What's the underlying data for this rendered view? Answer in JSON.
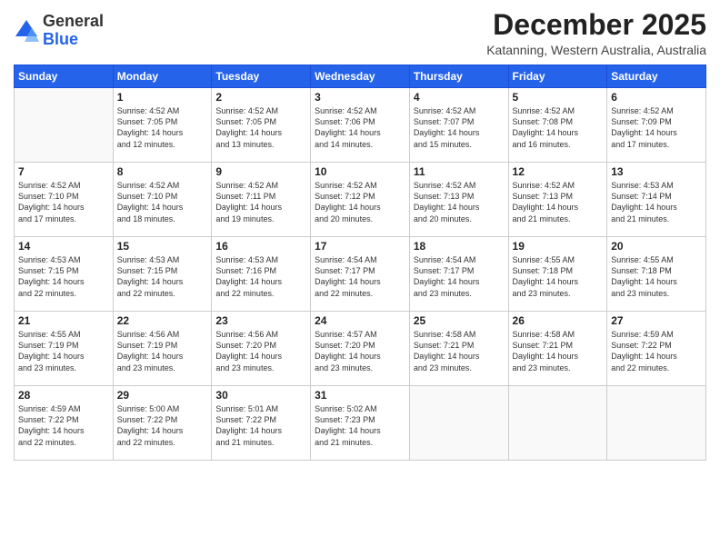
{
  "logo": {
    "general": "General",
    "blue": "Blue"
  },
  "title": "December 2025",
  "location": "Katanning, Western Australia, Australia",
  "days_header": [
    "Sunday",
    "Monday",
    "Tuesday",
    "Wednesday",
    "Thursday",
    "Friday",
    "Saturday"
  ],
  "weeks": [
    [
      {
        "day": "",
        "info": ""
      },
      {
        "day": "1",
        "info": "Sunrise: 4:52 AM\nSunset: 7:05 PM\nDaylight: 14 hours\nand 12 minutes."
      },
      {
        "day": "2",
        "info": "Sunrise: 4:52 AM\nSunset: 7:05 PM\nDaylight: 14 hours\nand 13 minutes."
      },
      {
        "day": "3",
        "info": "Sunrise: 4:52 AM\nSunset: 7:06 PM\nDaylight: 14 hours\nand 14 minutes."
      },
      {
        "day": "4",
        "info": "Sunrise: 4:52 AM\nSunset: 7:07 PM\nDaylight: 14 hours\nand 15 minutes."
      },
      {
        "day": "5",
        "info": "Sunrise: 4:52 AM\nSunset: 7:08 PM\nDaylight: 14 hours\nand 16 minutes."
      },
      {
        "day": "6",
        "info": "Sunrise: 4:52 AM\nSunset: 7:09 PM\nDaylight: 14 hours\nand 17 minutes."
      }
    ],
    [
      {
        "day": "7",
        "info": "Sunrise: 4:52 AM\nSunset: 7:10 PM\nDaylight: 14 hours\nand 17 minutes."
      },
      {
        "day": "8",
        "info": "Sunrise: 4:52 AM\nSunset: 7:10 PM\nDaylight: 14 hours\nand 18 minutes."
      },
      {
        "day": "9",
        "info": "Sunrise: 4:52 AM\nSunset: 7:11 PM\nDaylight: 14 hours\nand 19 minutes."
      },
      {
        "day": "10",
        "info": "Sunrise: 4:52 AM\nSunset: 7:12 PM\nDaylight: 14 hours\nand 20 minutes."
      },
      {
        "day": "11",
        "info": "Sunrise: 4:52 AM\nSunset: 7:13 PM\nDaylight: 14 hours\nand 20 minutes."
      },
      {
        "day": "12",
        "info": "Sunrise: 4:52 AM\nSunset: 7:13 PM\nDaylight: 14 hours\nand 21 minutes."
      },
      {
        "day": "13",
        "info": "Sunrise: 4:53 AM\nSunset: 7:14 PM\nDaylight: 14 hours\nand 21 minutes."
      }
    ],
    [
      {
        "day": "14",
        "info": "Sunrise: 4:53 AM\nSunset: 7:15 PM\nDaylight: 14 hours\nand 22 minutes."
      },
      {
        "day": "15",
        "info": "Sunrise: 4:53 AM\nSunset: 7:15 PM\nDaylight: 14 hours\nand 22 minutes."
      },
      {
        "day": "16",
        "info": "Sunrise: 4:53 AM\nSunset: 7:16 PM\nDaylight: 14 hours\nand 22 minutes."
      },
      {
        "day": "17",
        "info": "Sunrise: 4:54 AM\nSunset: 7:17 PM\nDaylight: 14 hours\nand 22 minutes."
      },
      {
        "day": "18",
        "info": "Sunrise: 4:54 AM\nSunset: 7:17 PM\nDaylight: 14 hours\nand 23 minutes."
      },
      {
        "day": "19",
        "info": "Sunrise: 4:55 AM\nSunset: 7:18 PM\nDaylight: 14 hours\nand 23 minutes."
      },
      {
        "day": "20",
        "info": "Sunrise: 4:55 AM\nSunset: 7:18 PM\nDaylight: 14 hours\nand 23 minutes."
      }
    ],
    [
      {
        "day": "21",
        "info": "Sunrise: 4:55 AM\nSunset: 7:19 PM\nDaylight: 14 hours\nand 23 minutes."
      },
      {
        "day": "22",
        "info": "Sunrise: 4:56 AM\nSunset: 7:19 PM\nDaylight: 14 hours\nand 23 minutes."
      },
      {
        "day": "23",
        "info": "Sunrise: 4:56 AM\nSunset: 7:20 PM\nDaylight: 14 hours\nand 23 minutes."
      },
      {
        "day": "24",
        "info": "Sunrise: 4:57 AM\nSunset: 7:20 PM\nDaylight: 14 hours\nand 23 minutes."
      },
      {
        "day": "25",
        "info": "Sunrise: 4:58 AM\nSunset: 7:21 PM\nDaylight: 14 hours\nand 23 minutes."
      },
      {
        "day": "26",
        "info": "Sunrise: 4:58 AM\nSunset: 7:21 PM\nDaylight: 14 hours\nand 23 minutes."
      },
      {
        "day": "27",
        "info": "Sunrise: 4:59 AM\nSunset: 7:22 PM\nDaylight: 14 hours\nand 22 minutes."
      }
    ],
    [
      {
        "day": "28",
        "info": "Sunrise: 4:59 AM\nSunset: 7:22 PM\nDaylight: 14 hours\nand 22 minutes."
      },
      {
        "day": "29",
        "info": "Sunrise: 5:00 AM\nSunset: 7:22 PM\nDaylight: 14 hours\nand 22 minutes."
      },
      {
        "day": "30",
        "info": "Sunrise: 5:01 AM\nSunset: 7:22 PM\nDaylight: 14 hours\nand 21 minutes."
      },
      {
        "day": "31",
        "info": "Sunrise: 5:02 AM\nSunset: 7:23 PM\nDaylight: 14 hours\nand 21 minutes."
      },
      {
        "day": "",
        "info": ""
      },
      {
        "day": "",
        "info": ""
      },
      {
        "day": "",
        "info": ""
      }
    ]
  ]
}
